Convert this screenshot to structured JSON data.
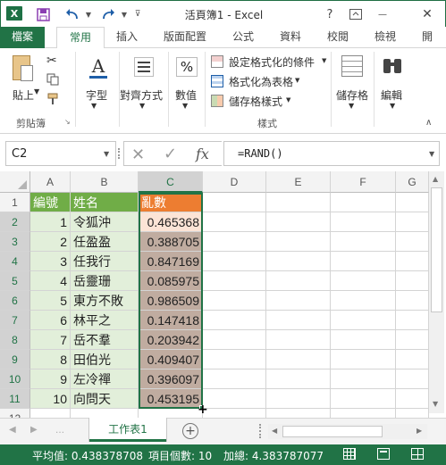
{
  "titlebar": {
    "title": "活頁簿1 - Excel",
    "app_icon": "X",
    "help": "?",
    "minimize": "—",
    "close": "✕"
  },
  "tabs": [
    "檔案",
    "常用",
    "插入",
    "版面配置",
    "公式",
    "資料",
    "校閱",
    "檢視",
    "開"
  ],
  "ribbon": {
    "clipboard": {
      "paste": "貼上",
      "label": "剪貼簿"
    },
    "font": {
      "label": "字型"
    },
    "align": {
      "label": "對齊方式"
    },
    "number": {
      "label": "數值",
      "symbol": "%"
    },
    "styles": {
      "conditional": "設定格式化的條件",
      "table": "格式化為表格",
      "cell": "儲存格樣式",
      "label": "樣式"
    },
    "cells": {
      "label": "儲存格"
    },
    "editing": {
      "label": "編輯"
    }
  },
  "formula_bar": {
    "name_box": "C2",
    "cancel": "✕",
    "enter": "✓",
    "fx": "fx",
    "formula": "=RAND()"
  },
  "columns": [
    "A",
    "B",
    "C",
    "D",
    "E",
    "F",
    "G"
  ],
  "rows": [
    "1",
    "2",
    "3",
    "4",
    "5",
    "6",
    "7",
    "8",
    "9",
    "10",
    "11",
    "12"
  ],
  "table": {
    "headers": [
      "編號",
      "姓名",
      "亂數"
    ],
    "data": [
      [
        "1",
        "令狐沖",
        "0.465368"
      ],
      [
        "2",
        "任盈盈",
        "0.388705"
      ],
      [
        "3",
        "任我行",
        "0.847169"
      ],
      [
        "4",
        "岳靈珊",
        "0.085975"
      ],
      [
        "5",
        "東方不敗",
        "0.986509"
      ],
      [
        "6",
        "林平之",
        "0.147418"
      ],
      [
        "7",
        "岳不羣",
        "0.203942"
      ],
      [
        "8",
        "田伯光",
        "0.409407"
      ],
      [
        "9",
        "左冷禪",
        "0.396097"
      ],
      [
        "10",
        "向問天",
        "0.453195"
      ]
    ]
  },
  "sheet": {
    "tab": "工作表1",
    "add": "+"
  },
  "status": {
    "average": "平均值: 0.438378708",
    "count": "項目個數: 10",
    "sum": "加總: 4.383787077"
  },
  "colors": {
    "excel_green": "#217346",
    "header_green": "#70ad47",
    "header_orange": "#ed7d31",
    "col_a_fill": "#e2efda",
    "col_c_fill": "#c0aca0",
    "c2_fill": "#fce4d6"
  }
}
